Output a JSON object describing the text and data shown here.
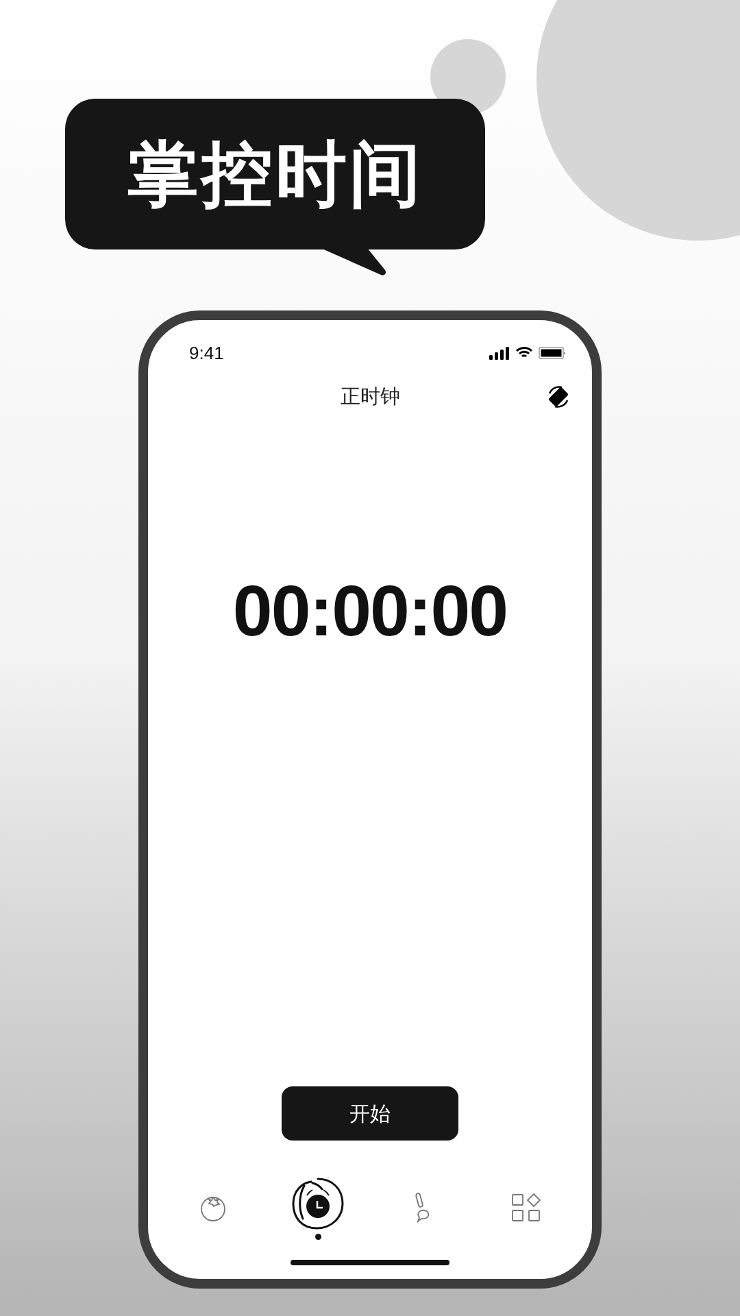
{
  "banner": {
    "title": "掌控时间"
  },
  "status_bar": {
    "time": "9:41"
  },
  "header": {
    "title": "正时钟"
  },
  "timer": {
    "display": "00:00:00"
  },
  "start_button": {
    "label": "开始"
  },
  "tabs": [
    {
      "kind": "tomato",
      "selected": false
    },
    {
      "kind": "clock",
      "selected": true
    },
    {
      "kind": "brush",
      "selected": false
    },
    {
      "kind": "apps",
      "selected": false
    }
  ]
}
